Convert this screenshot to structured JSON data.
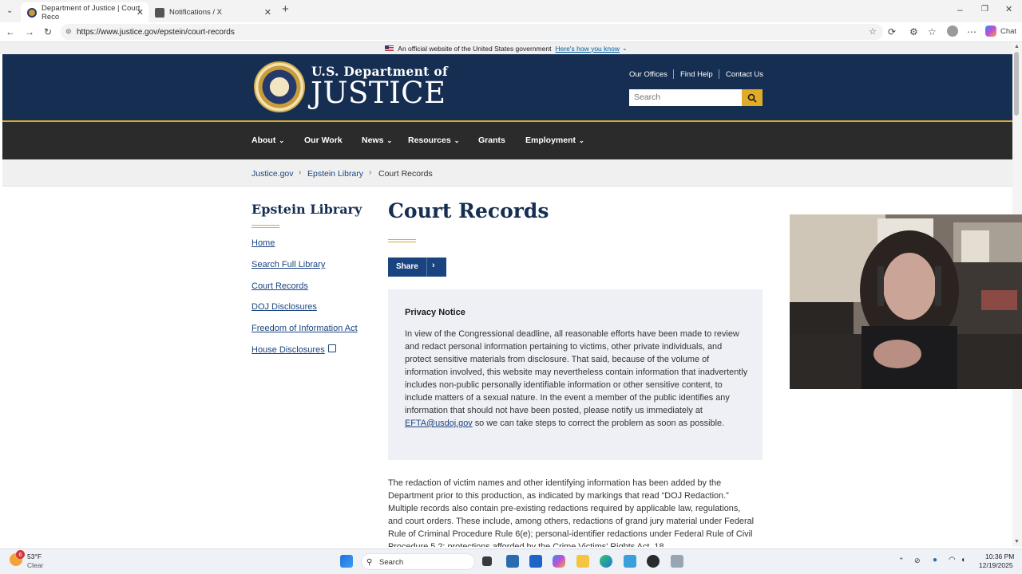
{
  "browser": {
    "tabs": [
      {
        "title": "Department of Justice | Court Reco"
      },
      {
        "title": "Notifications / X"
      }
    ],
    "url": "https://www.justice.gov/epstein/court-records",
    "chat_label": "Chat"
  },
  "gov_banner": {
    "text": "An official website of the United States government",
    "link": "Here's how you know"
  },
  "header": {
    "dept_line1": "U.S. Department of",
    "dept_line2": "JUSTICE",
    "links": [
      "Our Offices",
      "Find Help",
      "Contact Us"
    ],
    "search_placeholder": "Search"
  },
  "nav": {
    "items": [
      {
        "label": "About",
        "dropdown": true
      },
      {
        "label": "Our Work",
        "dropdown": false
      },
      {
        "label": "News",
        "dropdown": true
      },
      {
        "label": "Resources",
        "dropdown": true
      },
      {
        "label": "Grants",
        "dropdown": false
      },
      {
        "label": "Employment",
        "dropdown": true
      }
    ]
  },
  "breadcrumb": [
    "Justice.gov",
    "Epstein Library",
    "Court Records"
  ],
  "sidebar": {
    "title": "Epstein Library",
    "links": [
      "Home",
      "Search Full Library",
      "Court Records",
      "DOJ Disclosures",
      "Freedom of Information Act",
      "House Disclosures"
    ]
  },
  "main": {
    "title": "Court Records",
    "share_label": "Share",
    "notice_title": "Privacy Notice",
    "notice_text": "In view of the Congressional deadline, all reasonable efforts have been made to review and redact personal information pertaining to victims, other private individuals, and protect sensitive materials from disclosure.  That said, because of the volume of information involved, this website may nevertheless contain information that inadvertently includes non-public personally identifiable information or other sensitive content, to include matters of a sexual nature.  In the event a member of the public identifies any information that should not have been posted, please notify us immediately at",
    "notice_email": "EFTA@usdoj.gov",
    "notice_tail": "so we can take steps to correct the problem as soon as possible.",
    "paragraph": "The redaction of victim names and other identifying information has been added by the Department prior to this production, as indicated by markings that read “DOJ Redaction.” Multiple records also contain pre-existing redactions required by applicable law, regulations, and court orders. These include, among others, redactions of grand jury material under Federal Rule of Criminal Procedure Rule 6(e); personal-identifier redactions under Federal Rule of Civil Procedure 5.2; protections afforded by the Crime Victims' Rights Act, 18"
  },
  "taskbar": {
    "weather_temp": "53°F",
    "weather_desc": "Clear",
    "weather_badge": "6",
    "search_label": "Search",
    "time": "10:36 PM",
    "date": "12/19/2025"
  }
}
